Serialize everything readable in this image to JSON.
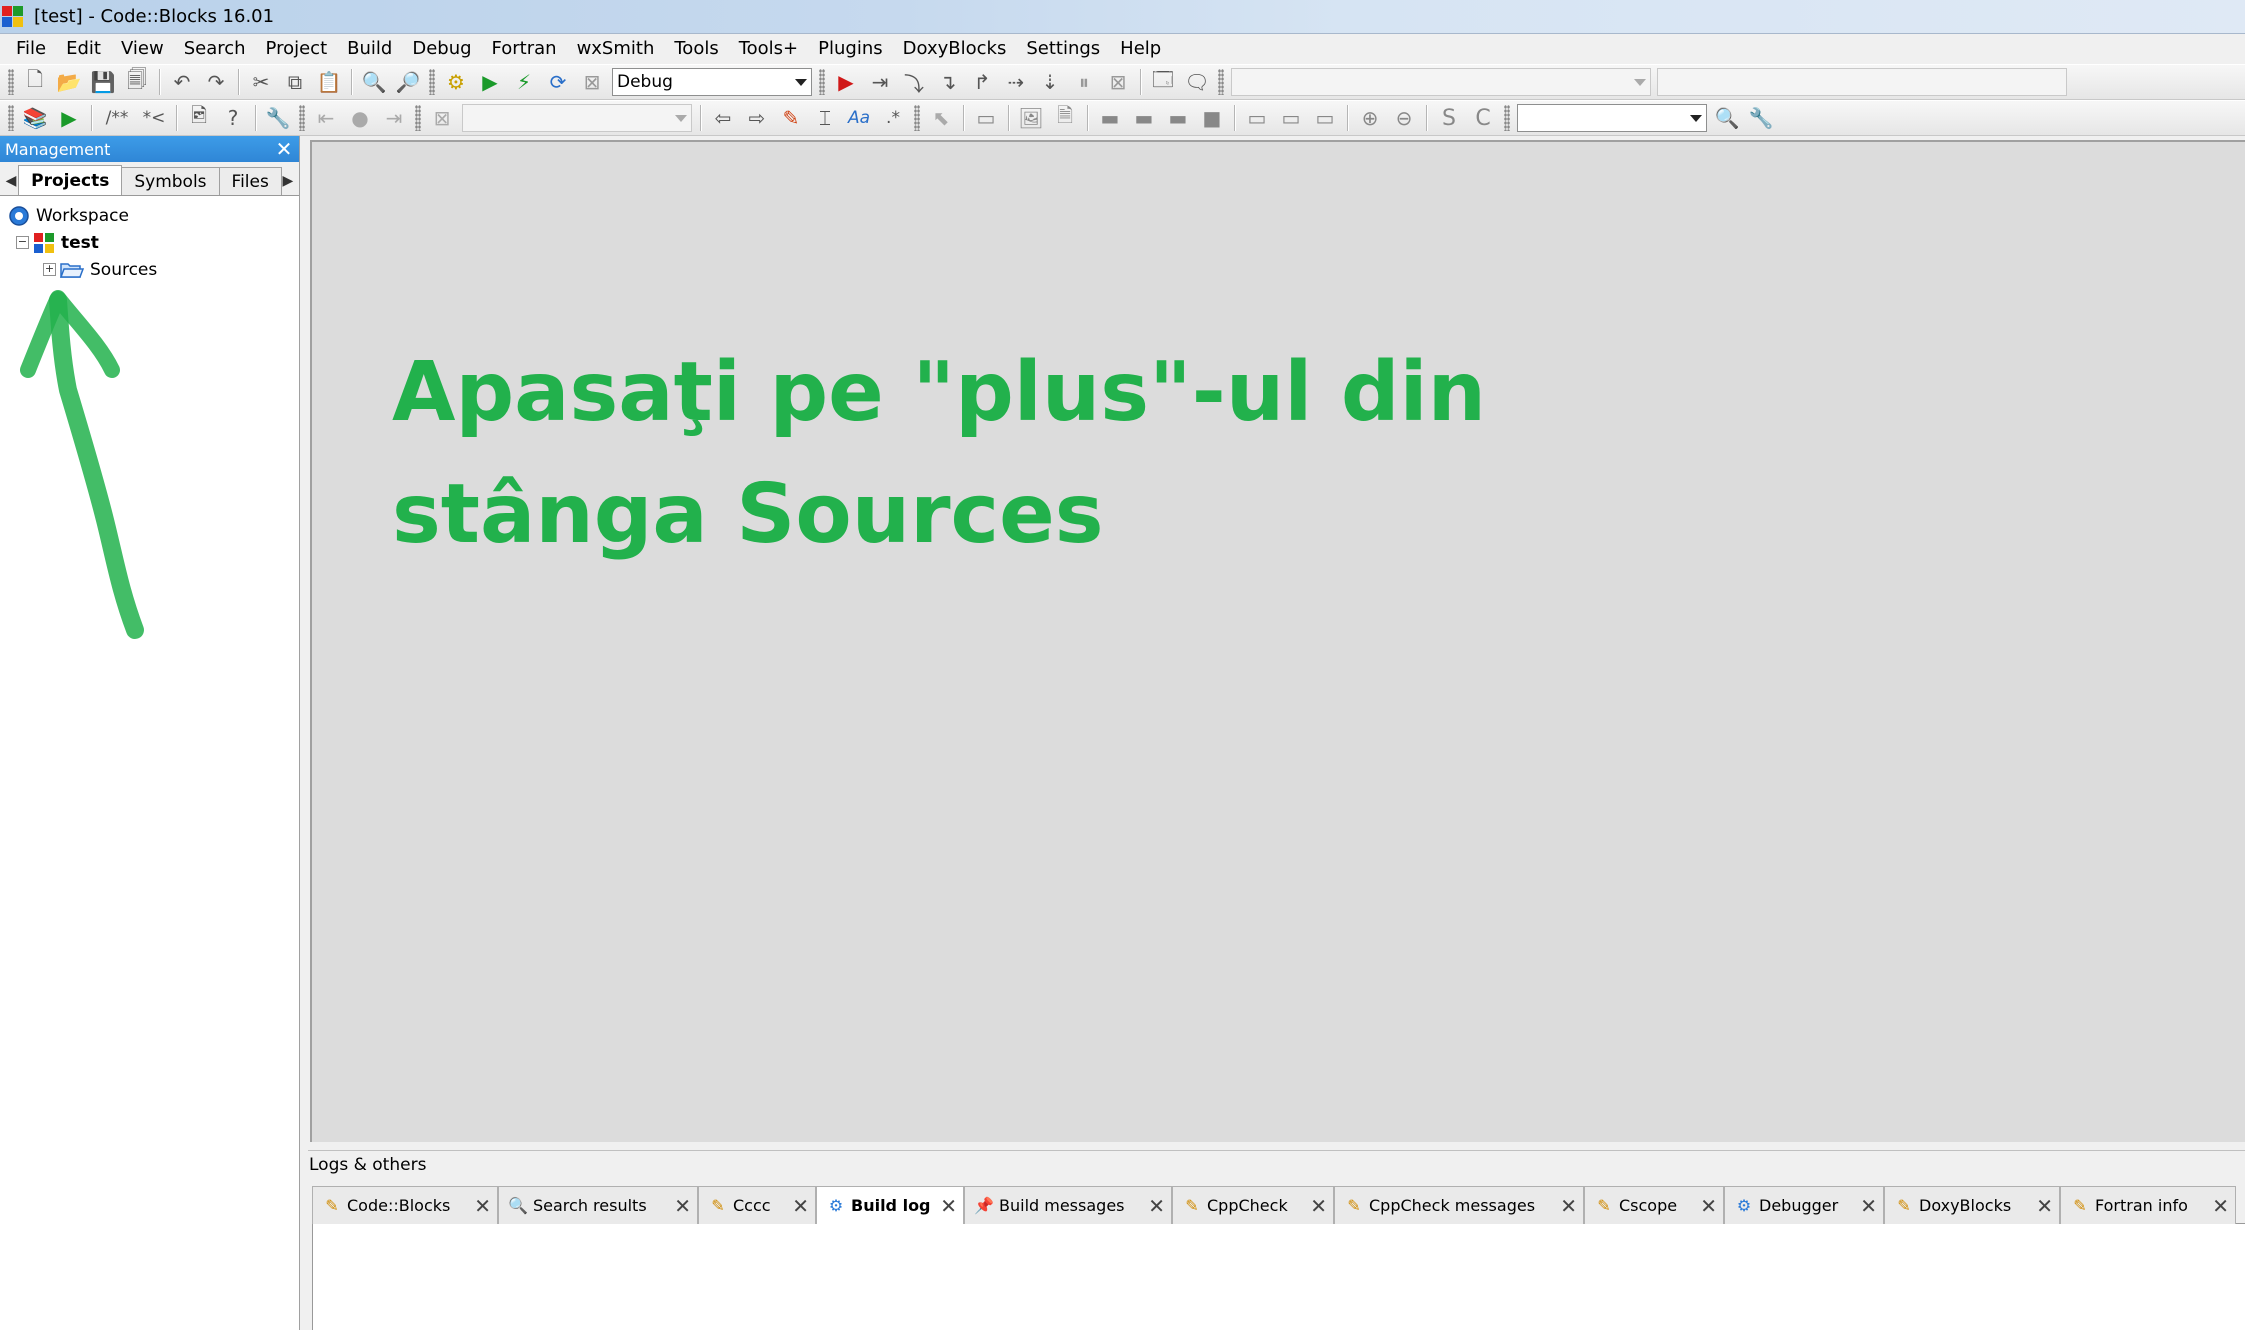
{
  "window": {
    "title": "[test] - Code::Blocks 16.01"
  },
  "menu": [
    "File",
    "Edit",
    "View",
    "Search",
    "Project",
    "Build",
    "Debug",
    "Fortran",
    "wxSmith",
    "Tools",
    "Tools+",
    "Plugins",
    "DoxyBlocks",
    "Settings",
    "Help"
  ],
  "toolbar": {
    "build_target": "Debug"
  },
  "management": {
    "title": "Management",
    "tabs": [
      "Projects",
      "Symbols",
      "Files"
    ],
    "tree": {
      "workspace": "Workspace",
      "project": "test",
      "folder": "Sources"
    }
  },
  "annotation": {
    "line1": "Apasaţi pe \"plus\"-ul din",
    "line2": "stânga Sources",
    "color": "#22b14c"
  },
  "logs": {
    "title": "Logs & others",
    "tabs": [
      "Code::Blocks",
      "Search results",
      "Cccc",
      "Build log",
      "Build messages",
      "CppCheck",
      "CppCheck messages",
      "Cscope",
      "Debugger",
      "DoxyBlocks",
      "Fortran info"
    ],
    "active_tab": "Build log"
  },
  "colors": {
    "accent": "#3d9ce8",
    "editor_bg": "#dcdcdc"
  }
}
